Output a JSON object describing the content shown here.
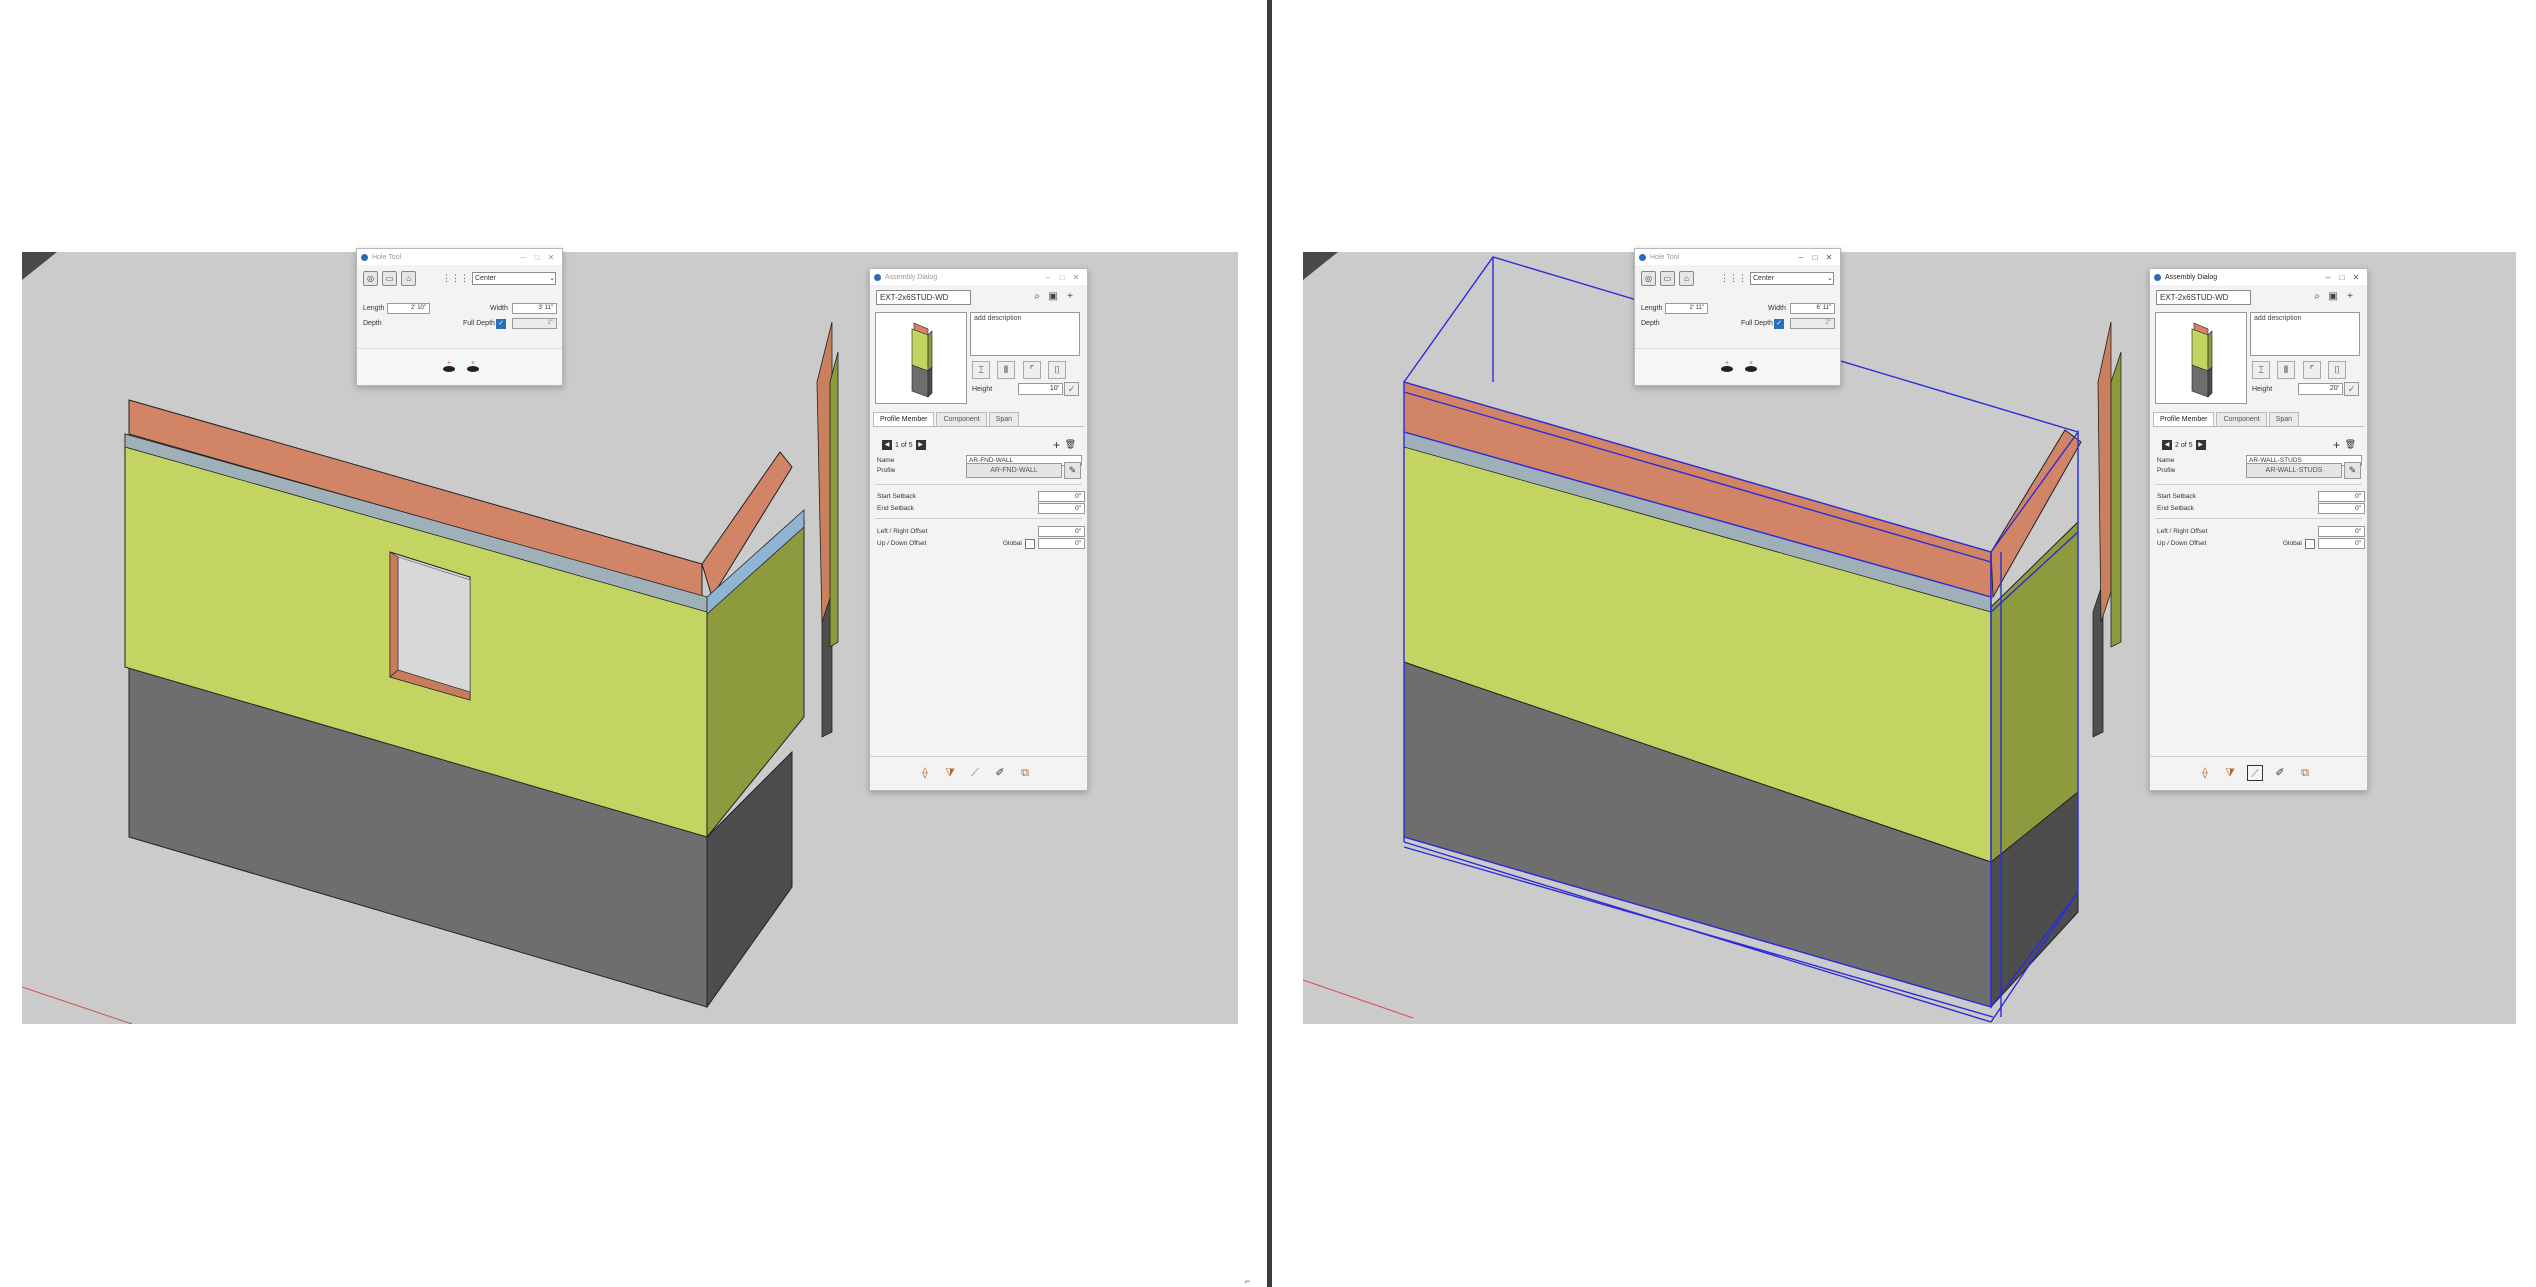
{
  "left": {
    "hole_tool": {
      "title": "Hole Tool",
      "placement": "Center",
      "length_label": "Length",
      "length_value": "2' 10\"",
      "width_label": "Width",
      "width_value": "3' 11\"",
      "depth_label": "Depth",
      "full_depth_label": "Full Depth",
      "full_depth_checked": true,
      "depth_value": "2\""
    },
    "assembly": {
      "title": "Assembly Dialog",
      "name": "EXT-2x6STUD-WD",
      "description_placeholder": "add description",
      "height_label": "Height",
      "height_value": "10'",
      "tabs": [
        "Profile Member",
        "Component",
        "Span"
      ],
      "pager": "1 of 5",
      "name_label": "Name",
      "name_value": "AR-FND-WALL",
      "profile_label": "Profile",
      "profile_value": "AR-FND-WALL",
      "start_setback_label": "Start Setback",
      "start_setback_value": "0\"",
      "end_setback_label": "End Setback",
      "end_setback_value": "0\"",
      "lr_offset_label": "Left / Right Offset",
      "lr_offset_value": "0\"",
      "ud_offset_label": "Up / Down Offset",
      "global_label": "Global",
      "ud_offset_value": "0\""
    }
  },
  "right": {
    "hole_tool": {
      "title": "Hole Tool",
      "placement": "Center",
      "length_label": "Length",
      "length_value": "2' 11\"",
      "width_label": "Width",
      "width_value": "6' 11\"",
      "depth_label": "Depth",
      "full_depth_label": "Full Depth",
      "full_depth_checked": true,
      "depth_value": "2\""
    },
    "assembly": {
      "title": "Assembly Dialog",
      "name": "EXT-2x6STUD-WD",
      "description_placeholder": "add description",
      "height_label": "Height",
      "height_value": "20'",
      "tabs": [
        "Profile Member",
        "Component",
        "Span"
      ],
      "pager": "2 of 5",
      "name_label": "Name",
      "name_value": "AR-WALL-STUDS",
      "profile_label": "Profile",
      "profile_value": "AR-WALL-STUDS",
      "start_setback_label": "Start Setback",
      "start_setback_value": "0\"",
      "end_setback_label": "End Setback",
      "end_setback_value": "0\"",
      "lr_offset_label": "Left / Right Offset",
      "lr_offset_value": "0\"",
      "ud_offset_label": "Up / Down Offset",
      "global_label": "Global",
      "ud_offset_value": "0\""
    }
  },
  "icons": {
    "search": "search-icon",
    "save": "save-icon",
    "add": "plus-icon",
    "trash": "trash-icon",
    "edit": "pencil-icon",
    "footer": [
      "profile-member-tool-icon",
      "component-tool-icon",
      "span-tool-icon",
      "eyedropper-icon",
      "layers-icon"
    ]
  },
  "colors": {
    "viewport_bg": "#cbcbcb",
    "wall_green": "#c4d462",
    "foundation_gray": "#6e6e6e",
    "top_plate": "#d28466",
    "selection_blue": "#2c2cd8"
  },
  "misc": {
    "corner_mark": "⌐"
  }
}
